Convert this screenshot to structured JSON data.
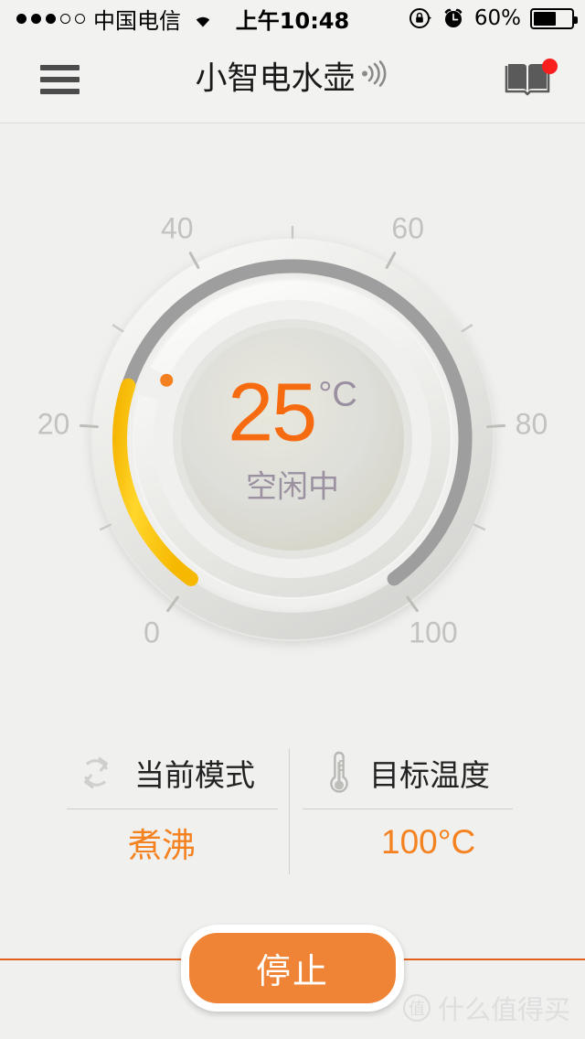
{
  "status_bar": {
    "signal_dots_filled": 3,
    "signal_dots_total": 5,
    "carrier": "中国电信",
    "wifi_icon": "wifi-icon",
    "time": "上午10:48",
    "rotation_lock_icon": "rotation-lock-icon",
    "alarm_icon": "alarm-clock-icon",
    "battery_percent": "60%",
    "battery_level": 60
  },
  "navbar": {
    "menu_icon": "hamburger-menu-icon",
    "title": "小智电水壶",
    "signal_icon": "broadcast-signal-icon",
    "book_icon": "book-icon",
    "badge_visible": true
  },
  "dial": {
    "current_temp": "25",
    "unit": "°C",
    "state": "空闲中",
    "min": 0,
    "max": 100,
    "tick_labels": [
      "0",
      "20",
      "40",
      "60",
      "80",
      "100"
    ],
    "tick_values": [
      0,
      20,
      40,
      60,
      80,
      100
    ],
    "minor_tick_values": [
      10,
      30,
      50,
      70,
      90
    ],
    "progress_value": 25,
    "progress_color": "#FBC10A",
    "track_color": "#9e9e9e",
    "temp_color": "#F76B10",
    "state_color": "#9B91A1"
  },
  "info_panels": [
    {
      "icon": "refresh-cycle-icon",
      "label": "当前模式",
      "value": "煮沸"
    },
    {
      "icon": "thermometer-icon",
      "label": "目标温度",
      "value": "100°C"
    }
  ],
  "action": {
    "label": "停止",
    "color": "#EF8336"
  },
  "watermark": {
    "badge": "值",
    "text": "什么值得买"
  }
}
